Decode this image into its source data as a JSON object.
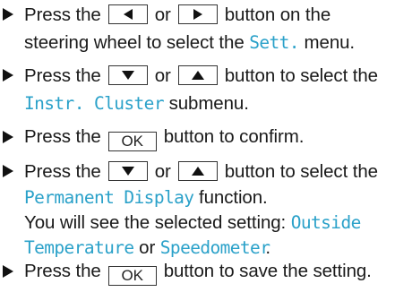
{
  "steps": [
    {
      "a": "Press the",
      "b": "or",
      "c": "button on the",
      "d": "steering wheel to select the",
      "e": "Sett.",
      "f": "menu."
    },
    {
      "a": "Press the",
      "b": "or",
      "c": "button to select the",
      "e": "Instr. Cluster",
      "f": "submenu."
    },
    {
      "a": "Press the",
      "key": "OK",
      "c": "button to confirm."
    },
    {
      "a": "Press the",
      "b": "or",
      "c": "button to select the",
      "e": "Permanent Display",
      "f": "function.",
      "g": "You will see the selected setting:",
      "h": "Outside",
      "i": "Temperature",
      "j": "or",
      "k": "Speedometer",
      "l": "."
    },
    {
      "a": "Press the",
      "key": "OK",
      "c": "button to save the setting."
    }
  ],
  "icons": {
    "bullet": "right-triangle-bullet-icon",
    "left": "left-arrow-button-icon",
    "right": "right-arrow-button-icon",
    "down": "down-arrow-button-icon",
    "up": "up-arrow-button-icon"
  },
  "colors": {
    "text": "#1a1a1a",
    "highlight": "#2aa1c9"
  }
}
